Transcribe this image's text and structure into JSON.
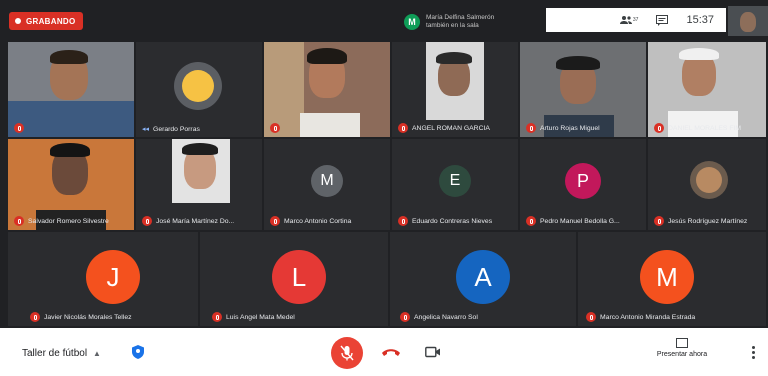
{
  "recording_label": "GRABANDO",
  "notification": {
    "avatar": "M",
    "line1": "María Delfina Salmerón",
    "line2": "también en la sala"
  },
  "topbar": {
    "people_count": "37",
    "time": "15:37",
    "people_icon": "people-icon",
    "chat_icon": "chat-icon"
  },
  "participants_row1": [
    {
      "name": "",
      "kind": "video"
    },
    {
      "name": "Gerardo Porras",
      "kind": "avatar-photo"
    },
    {
      "name": "",
      "kind": "video"
    },
    {
      "name": "ANGEL ROMAN GARCIA",
      "kind": "video"
    },
    {
      "name": "Arturo Rojas Miguel",
      "kind": "video"
    },
    {
      "name": "DANIEL MORALES FIM",
      "kind": "video"
    }
  ],
  "participants_row2": [
    {
      "name": "Salvador Romero Silvestre",
      "kind": "video"
    },
    {
      "name": "José María Martínez Do...",
      "kind": "video"
    },
    {
      "name": "Marco Antonio Cortina",
      "letter": "M",
      "color": "#5f6368"
    },
    {
      "name": "Eduardo Contreras Nieves",
      "letter": "E",
      "color": "#2e4a3e"
    },
    {
      "name": "Pedro Manuel Bedolla G...",
      "letter": "P",
      "color": "#c2185b"
    },
    {
      "name": "Jesús Rodríguez Martínez",
      "kind": "avatar-photo"
    }
  ],
  "participants_row3": [
    {
      "name": "Javier Nicolás Morales Tellez",
      "letter": "J",
      "color": "#f4511e"
    },
    {
      "name": "Luis Angel Mata Medel",
      "letter": "L",
      "color": "#e53935"
    },
    {
      "name": "Angelica Navarro Sol",
      "letter": "A",
      "color": "#1565c0"
    },
    {
      "name": "Marco Antonio Miranda Estrada",
      "letter": "M",
      "color": "#f4511e"
    }
  ],
  "bottombar": {
    "meeting_name": "Taller de fútbol",
    "present_label": "Presentar ahora"
  }
}
